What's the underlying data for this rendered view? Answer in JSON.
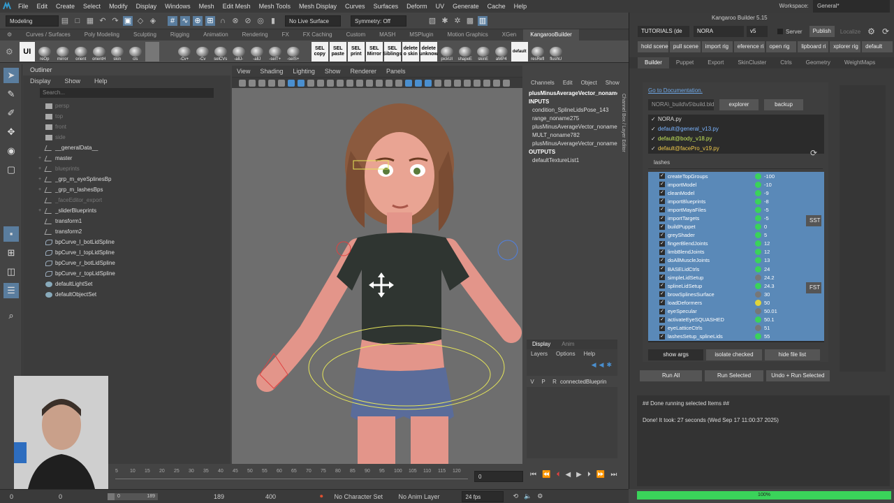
{
  "menubar": {
    "items": [
      "File",
      "Edit",
      "Create",
      "Select",
      "Modify",
      "Display",
      "Windows",
      "Mesh",
      "Edit Mesh",
      "Mesh Tools",
      "Mesh Display",
      "Curves",
      "Surfaces",
      "Deform",
      "UV",
      "Generate",
      "Cache",
      "Help"
    ],
    "workspace_label": "Workspace:",
    "workspace_value": "General*"
  },
  "statusline": {
    "mode": "Modeling",
    "live_surface": "No Live Surface",
    "symmetry": "Symmetry: Off"
  },
  "shelf": {
    "tabs": [
      "Curves / Surfaces",
      "Poly Modeling",
      "Sculpting",
      "Rigging",
      "Animation",
      "Rendering",
      "FX",
      "FX Caching",
      "Custom",
      "MASH",
      "MSPlugin",
      "Motion Graphics",
      "XGen",
      "KangarooBuilder"
    ],
    "active_tab": "KangarooBuilder",
    "buttons1": [
      "reOp",
      "mirror",
      "orient",
      "orientH",
      "skin",
      "cls"
    ],
    "buttons2": [
      "-Cv+",
      "-Cv",
      "selCVs",
      "-allJ-",
      "-allJ",
      "-selT+",
      "-selS+"
    ],
    "white_buttons": [
      "SEL copy",
      "SEL paste",
      "SEL print",
      "SEL Mirror",
      "SEL Siblings",
      "delete o skin",
      "delete unknow"
    ],
    "buttons3": [
      "pickUI",
      "shapeE",
      "skinE",
      "aMP4"
    ],
    "default_label": "default",
    "buttons4": [
      "resRefl",
      "flushU"
    ],
    "ui_label": "UI"
  },
  "outliner": {
    "title": "Outliner",
    "menu": [
      "Display",
      "Show",
      "Help"
    ],
    "search_placeholder": "Search...",
    "items": [
      {
        "label": "persp",
        "dim": true,
        "exp": ""
      },
      {
        "label": "top",
        "dim": true,
        "exp": ""
      },
      {
        "label": "front",
        "dim": true,
        "exp": ""
      },
      {
        "label": "side",
        "dim": true,
        "exp": ""
      },
      {
        "label": "__generalData__",
        "dim": false,
        "exp": ""
      },
      {
        "label": "master",
        "dim": false,
        "exp": "+"
      },
      {
        "label": "blueprints",
        "dim": true,
        "exp": "+"
      },
      {
        "label": "_grp_m_eyeSplinesBp",
        "dim": false,
        "exp": "+"
      },
      {
        "label": "_grp_m_lashesBps",
        "dim": false,
        "exp": "+"
      },
      {
        "label": "_faceEditor_export",
        "dim": true,
        "exp": ""
      },
      {
        "label": "_sliderBlueprints",
        "dim": false,
        "exp": "+"
      },
      {
        "label": "transform1",
        "dim": false,
        "exp": ""
      },
      {
        "label": "transform2",
        "dim": false,
        "exp": ""
      },
      {
        "label": "bpCurve_l_botLidSpline",
        "dim": false,
        "exp": ""
      },
      {
        "label": "bpCurve_l_topLidSpline",
        "dim": false,
        "exp": ""
      },
      {
        "label": "bpCurve_r_botLidSpline",
        "dim": false,
        "exp": ""
      },
      {
        "label": "bpCurve_r_topLidSpline",
        "dim": false,
        "exp": ""
      },
      {
        "label": "defaultLightSet",
        "dim": false,
        "exp": ""
      },
      {
        "label": "defaultObjectSet",
        "dim": false,
        "exp": ""
      }
    ]
  },
  "viewport": {
    "menu": [
      "View",
      "Shading",
      "Lighting",
      "Show",
      "Renderer",
      "Panels"
    ]
  },
  "channelbox": {
    "menu": [
      "Channels",
      "Edit",
      "Object",
      "Show"
    ],
    "node": "plusMinusAverageVector_noname5",
    "inputs_label": "INPUTS",
    "inputs": [
      "condition_SplineLidsPose_143",
      "range_noname275",
      "plusMinusAverageVector_noname",
      "MULT_noname782",
      "plusMinusAverageVector_noname"
    ],
    "outputs_label": "OUTPUTS",
    "outputs": [
      "defaultTextureList1"
    ],
    "vertical_tab": "Channel Box / Layer Editor"
  },
  "layers": {
    "tabs": [
      "Display",
      "Anim"
    ],
    "menu": [
      "Layers",
      "Options",
      "Help"
    ],
    "row": {
      "v": "V",
      "p": "P",
      "r": "R",
      "name": "connectedBlueprin"
    }
  },
  "kangaroo": {
    "title": "Kangaroo Builder 5.15",
    "tutorials": "TUTORIALS (de",
    "asset": "NORA",
    "version": "v5",
    "server": "Server",
    "publish": "Publish",
    "localize": "Localize",
    "toolbar": [
      "hold scene",
      "pull scene",
      "import rig",
      "eference ri",
      "open rig",
      "lipboard ri",
      "xplorer rig",
      "default"
    ],
    "tabs": [
      "Builder",
      "Puppet",
      "Export",
      "SkinCluster",
      "Ctrls",
      "Geometry",
      "WeightMaps"
    ],
    "doc_link": "Go to Documentation.",
    "path": "NORA\\_build\\v5\\build.bld",
    "explorer": "explorer",
    "backup": "backup",
    "files": [
      {
        "label": "NORA.py",
        "color": "#dddddd"
      },
      {
        "label": "default@general_v13.py",
        "color": "#7ab4ff"
      },
      {
        "label": "default@body_v18.py",
        "color": "#c7e85a"
      },
      {
        "label": "default@facePro_v19.py",
        "color": "#f0c94a"
      }
    ],
    "filter": "lashes",
    "functions": [
      {
        "name": "createTopGroups",
        "val": "-100",
        "c": "#3ad35a"
      },
      {
        "name": "importModel",
        "val": "-10",
        "c": "#3ad35a"
      },
      {
        "name": "cleanModel",
        "val": "-9",
        "c": "#3ad35a"
      },
      {
        "name": "importBlueprints",
        "val": "-8",
        "c": "#3ad35a"
      },
      {
        "name": "importMayaFiles",
        "val": "-5",
        "c": "#3ad35a"
      },
      {
        "name": "importTargets",
        "val": "-5",
        "c": "#3ad35a"
      },
      {
        "name": "buildPuppet",
        "val": "0",
        "c": "#3ad35a"
      },
      {
        "name": "greyShader",
        "val": "5",
        "c": "#3ad35a"
      },
      {
        "name": "fingerBlendJoints",
        "val": "12",
        "c": "#3ad35a"
      },
      {
        "name": "limbBlendJoints",
        "val": "12",
        "c": "#3ad35a"
      },
      {
        "name": "doAllMuscleJoints",
        "val": "13",
        "c": "#3ad35a"
      },
      {
        "name": "BASELidCtrls",
        "val": "24",
        "c": "#3ad35a"
      },
      {
        "name": "simpleLidSetup",
        "val": "24.2",
        "c": "#777777"
      },
      {
        "name": "splineLidSetup",
        "val": "24.3",
        "c": "#3ad35a"
      },
      {
        "name": "browSplinesSurface",
        "val": "30",
        "c": "#777777"
      },
      {
        "name": "loadDeformers",
        "val": "50",
        "c": "#e0d43a"
      },
      {
        "name": "eyeSpecular",
        "val": "50.01",
        "c": "#777777"
      },
      {
        "name": "activateEyeSQUASHED",
        "val": "50.1",
        "c": "#3ad35a"
      },
      {
        "name": "eyeLatticeCtrls",
        "val": "51",
        "c": "#777777"
      },
      {
        "name": "lashesSetup_splineLids",
        "val": "55",
        "c": "#3ad35a"
      }
    ],
    "side_buttons": [
      "SST",
      "FST"
    ],
    "bottom_buttons": [
      "show args",
      "isolate checked",
      "hide file list"
    ],
    "run_all": "Run All",
    "run_selected": "Run Selected",
    "undo_run": "Undo + Run Selected",
    "log1": "## Done running selected Items ##",
    "log2": "Done! It took: 27 seconds (Wed Sep 17 11:00:37 2025)",
    "progress": "100%"
  },
  "timeline": {
    "ticks": [
      "5",
      "10",
      "15",
      "20",
      "25",
      "30",
      "35",
      "40",
      "45",
      "50",
      "55",
      "60",
      "65",
      "70",
      "75",
      "80",
      "85",
      "90",
      "95",
      "100",
      "105",
      "110",
      "115",
      "120"
    ],
    "current": "0",
    "range_start": "0",
    "range_start2": "0",
    "slider_a": "0",
    "slider_b": "189",
    "range_end": "189",
    "range_end2": "400",
    "character_set": "No Character Set",
    "anim_layer": "No Anim Layer",
    "fps": "24 fps"
  }
}
